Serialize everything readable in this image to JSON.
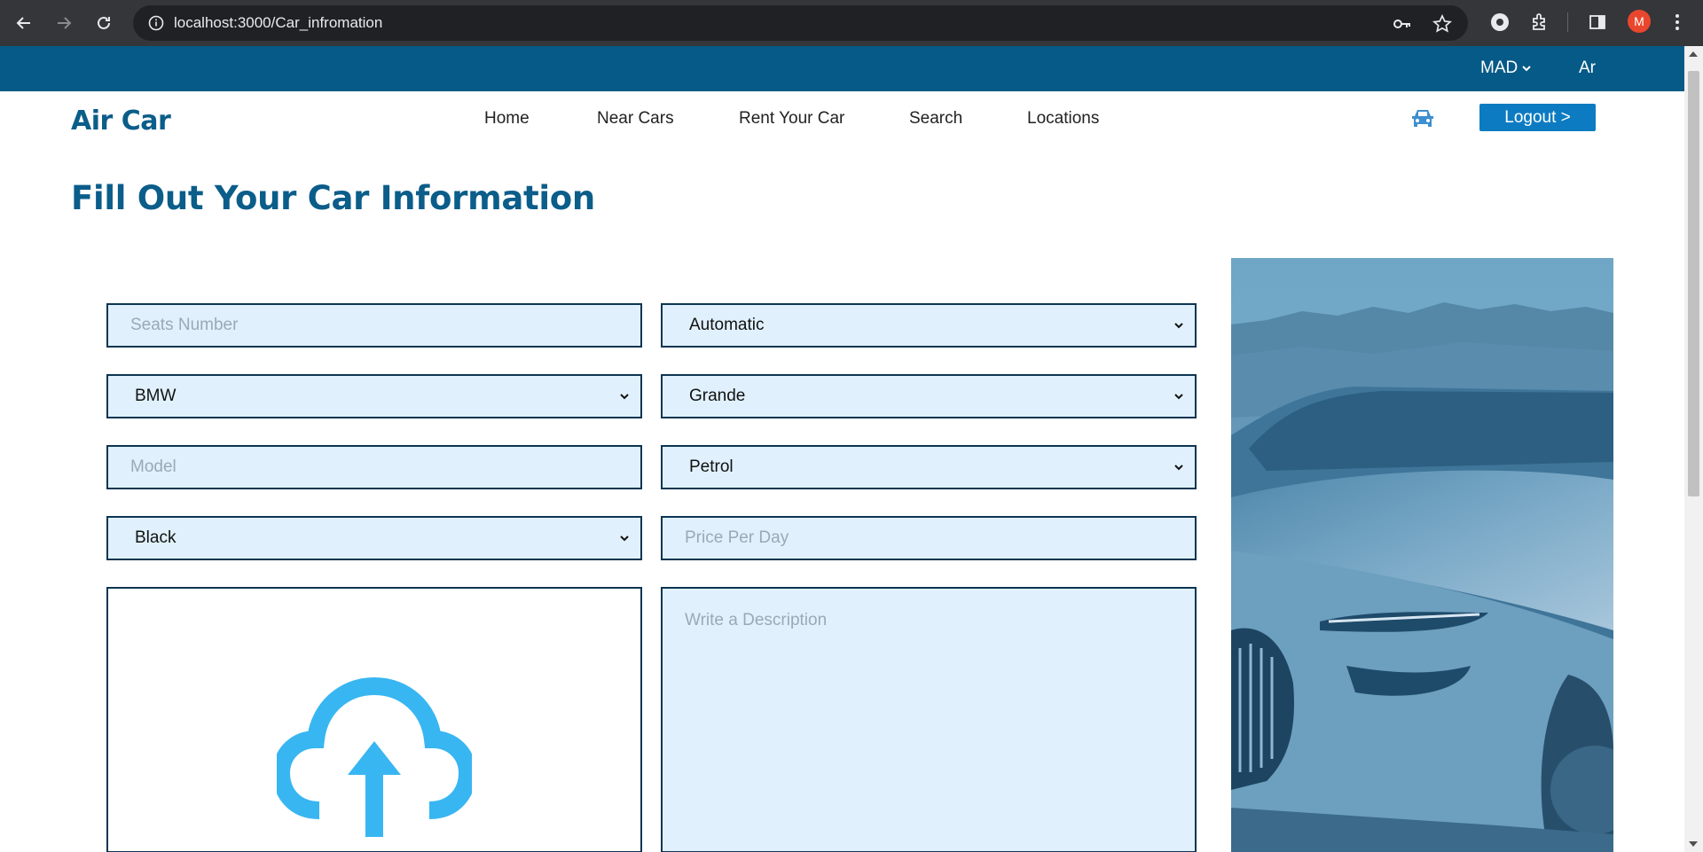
{
  "browser": {
    "url": "localhost:3000/Car_infromation",
    "profile_initial": "M"
  },
  "topbar": {
    "currency": "MAD",
    "language": "Ar"
  },
  "header": {
    "logo": "Air Car",
    "nav": [
      "Home",
      "Near Cars",
      "Rent Your Car",
      "Search",
      "Locations"
    ],
    "logout_label": "Logout >"
  },
  "page_title": "Fill Out Your Car Information",
  "form": {
    "seats_placeholder": "Seats Number",
    "transmission": "Automatic",
    "brand": "BMW",
    "city": "Grande",
    "model_placeholder": "Model",
    "fuel": "Petrol",
    "color": "Black",
    "price_placeholder": "Price Per Day",
    "description_placeholder": "Write a Description"
  },
  "colors": {
    "topbar": "#065a87",
    "brand": "#0b5d8a",
    "field_bg": "#e0f1fd",
    "upload_icon": "#38b6f2",
    "logout": "#0d7bc1"
  }
}
